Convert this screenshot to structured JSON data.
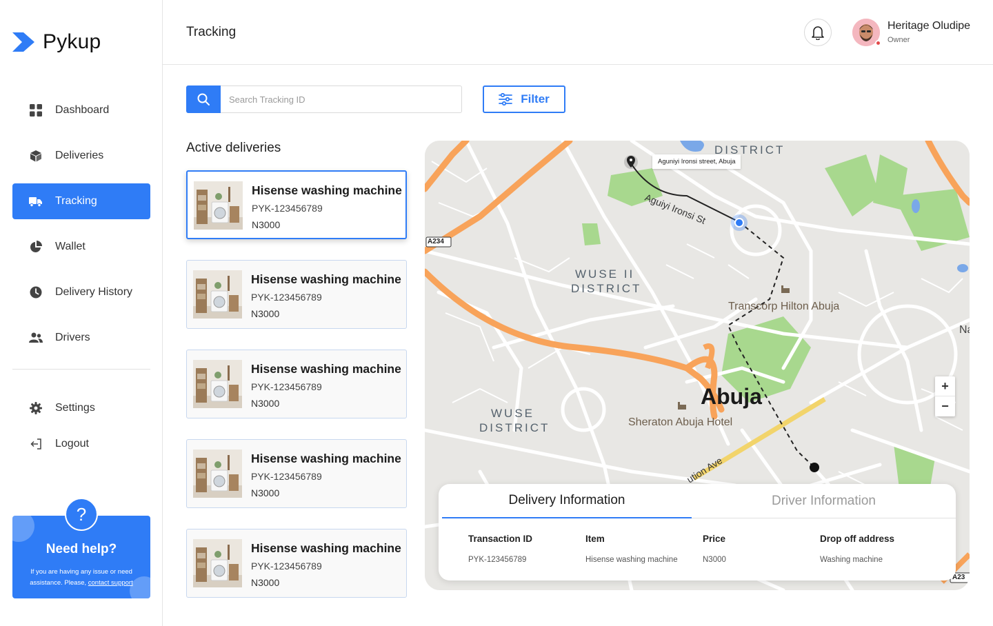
{
  "app": {
    "name": "Pykup"
  },
  "sidebar": {
    "items": [
      {
        "label": "Dashboard",
        "icon": "dashboard-icon"
      },
      {
        "label": "Deliveries",
        "icon": "box-icon"
      },
      {
        "label": "Tracking",
        "icon": "truck-icon",
        "active": true
      },
      {
        "label": "Wallet",
        "icon": "pie-chart-icon"
      },
      {
        "label": "Delivery History",
        "icon": "clock-icon"
      },
      {
        "label": "Drivers",
        "icon": "users-icon"
      }
    ],
    "bottom_items": [
      {
        "label": "Settings",
        "icon": "gear-icon"
      },
      {
        "label": "Logout",
        "icon": "logout-icon"
      }
    ],
    "help": {
      "title": "Need help?",
      "text": "If you are having any issue or need assistance. Please,",
      "link": "contact support"
    }
  },
  "header": {
    "title": "Tracking",
    "user": {
      "name": "Heritage Oludipe",
      "role": "Owner"
    }
  },
  "search": {
    "placeholder": "Search Tracking ID",
    "value": ""
  },
  "filter": {
    "label": "Filter"
  },
  "deliveries": {
    "title": "Active deliveries",
    "items": [
      {
        "name": "Hisense washing machine",
        "id": "PYK-123456789",
        "price": "N3000"
      },
      {
        "name": "Hisense washing machine",
        "id": "PYK-123456789",
        "price": "N3000"
      },
      {
        "name": "Hisense washing machine",
        "id": "PYK-123456789",
        "price": "N3000"
      },
      {
        "name": "Hisense washing machine",
        "id": "PYK-123456789",
        "price": "N3000"
      },
      {
        "name": "Hisense washing machine",
        "id": "PYK-123456789",
        "price": "N3000"
      }
    ]
  },
  "map": {
    "address_tag": "Aguniyi Ironsi street, Abuja",
    "labels": {
      "district_top": "DISTRICT",
      "wuse2_line1": "WUSE II",
      "wuse2_line2": "DISTRICT",
      "wuse_line1": "WUSE",
      "wuse_line2": "DISTRICT",
      "city": "Abuja",
      "hotel1": "Transcorp Hilton Abuja",
      "hotel2": "Sheraton Abuja Hotel",
      "street1": "Aguiyi Ironsi St",
      "street2": "ution Ave",
      "road1": "A234",
      "road2": "A23",
      "edge": "Na"
    },
    "zoom_in": "+",
    "zoom_out": "−"
  },
  "info": {
    "tabs": [
      "Delivery Information",
      "Driver Information"
    ],
    "columns": [
      {
        "header": "Transaction ID",
        "value": "PYK-123456789"
      },
      {
        "header": "Item",
        "value": "Hisense washing machine"
      },
      {
        "header": "Price",
        "value": "N3000"
      },
      {
        "header": "Drop off address",
        "value": "Washing machine"
      }
    ]
  },
  "colors": {
    "primary": "#2f7cf6",
    "road_major": "#f8a35a",
    "park": "#a8d88e"
  }
}
